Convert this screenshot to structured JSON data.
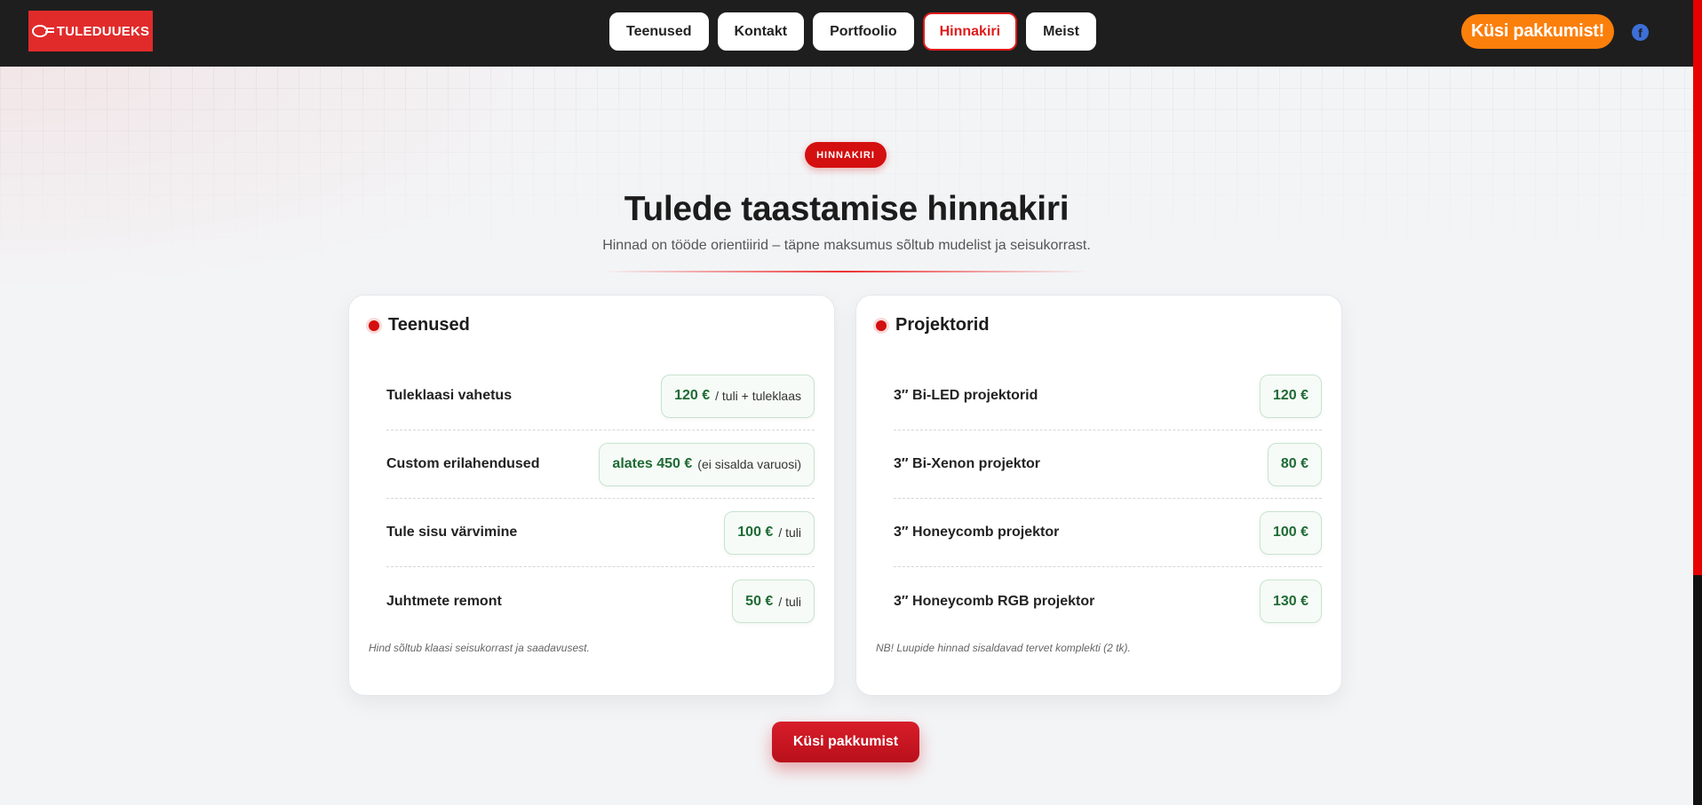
{
  "header": {
    "logo_text": "TULEDUUEKS",
    "nav": [
      {
        "label": "Teenused",
        "active": false
      },
      {
        "label": "Kontakt",
        "active": false
      },
      {
        "label": "Portfoolio",
        "active": false
      },
      {
        "label": "Hinnakiri",
        "active": true
      },
      {
        "label": "Meist",
        "active": false
      }
    ],
    "cta_label": "Küsi pakkumist!",
    "social_icon": "facebook-icon"
  },
  "hero": {
    "badge": "HINNAKIRI",
    "title": "Tulede taastamise hinnakiri",
    "subtitle": "Hinnad on tööde orientiirid – täpne maksumus sõltub mudelist ja seisukorrast."
  },
  "cards": {
    "services": {
      "title": "Teenused",
      "rows": [
        {
          "label": "Tuleklaasi vahetus",
          "price": "120 €",
          "unit": "/ tuli + tuleklaas"
        },
        {
          "label": "Custom erilahendused",
          "price": "alates 450 €",
          "unit": "(ei sisalda varuosi)"
        },
        {
          "label": "Tule sisu värvimine",
          "price": "100 €",
          "unit": "/ tuli"
        },
        {
          "label": "Juhtmete remont",
          "price": "50 €",
          "unit": "/ tuli"
        }
      ],
      "note": "Hind sõltub klaasi seisukorrast ja saadavusest."
    },
    "projectors": {
      "title": "Projektorid",
      "rows": [
        {
          "label": "3″ Bi-LED projektorid",
          "price": "120 €",
          "unit": ""
        },
        {
          "label": "3″ Bi-Xenon projektor",
          "price": "80 €",
          "unit": ""
        },
        {
          "label": "3″ Honeycomb projektor",
          "price": "100 €",
          "unit": ""
        },
        {
          "label": "3″ Honeycomb RGB projektor",
          "price": "130 €",
          "unit": ""
        }
      ],
      "note": "NB! Luupide hinnad sisaldavad tervet komplekti (2 tk)."
    }
  },
  "bottom_cta": "Küsi pakkumist",
  "colors": {
    "accent_red": "#d40f0f",
    "orange": "#fb7f0b",
    "price_green": "#1f6a35"
  }
}
